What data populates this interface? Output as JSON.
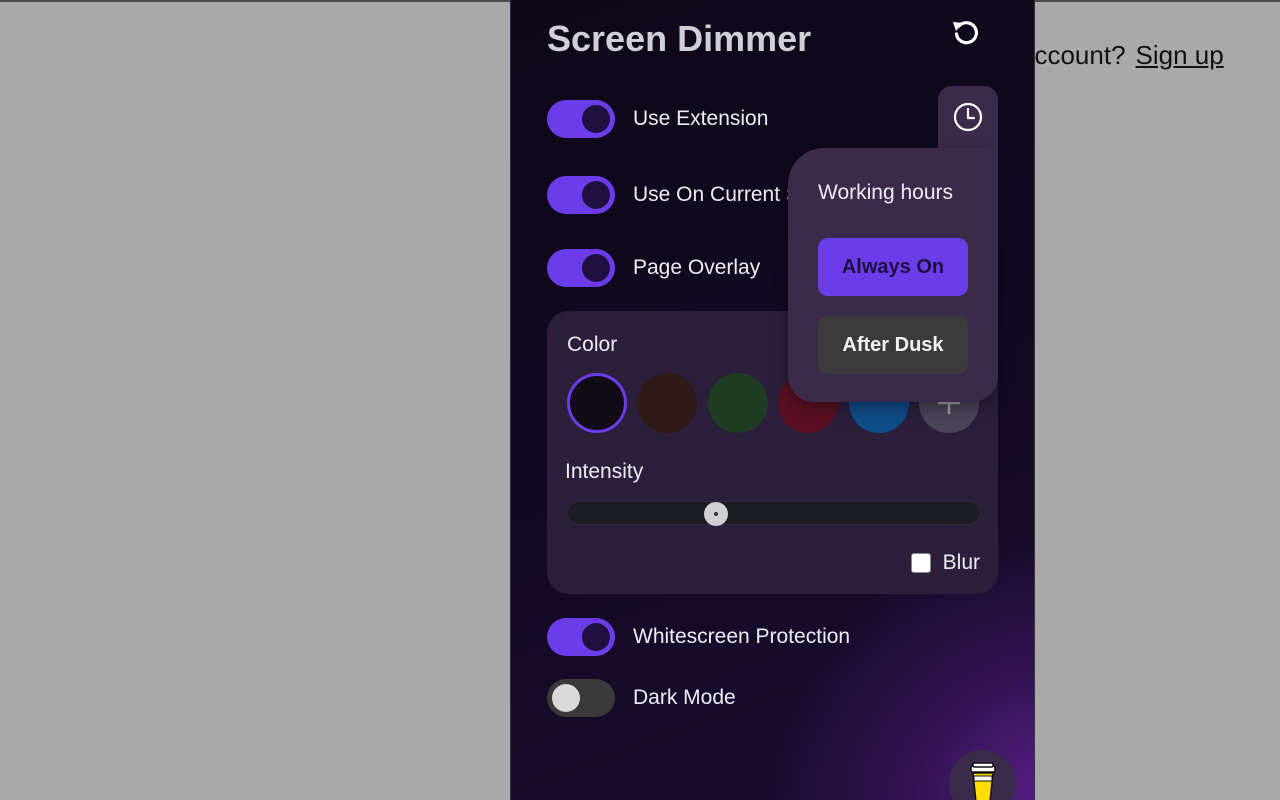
{
  "background_page": {
    "prompt": "account?",
    "signup_link": "Sign up"
  },
  "panel": {
    "title": "Screen Dimmer",
    "reset_icon": "reset-icon",
    "toggles": [
      {
        "label": "Use Extension",
        "on": true
      },
      {
        "label": "Use On Current Site",
        "on": true
      },
      {
        "label": "Page Overlay",
        "on": true
      },
      {
        "label": "Whitescreen Protection",
        "on": true
      },
      {
        "label": "Dark Mode",
        "on": false
      }
    ],
    "overlay": {
      "color_label": "Color",
      "swatches": [
        {
          "name": "black",
          "color": "#110c16",
          "selected": true
        },
        {
          "name": "brown",
          "color": "#2e1a16",
          "selected": false
        },
        {
          "name": "green",
          "color": "#1f3d22",
          "selected": false
        },
        {
          "name": "red",
          "color": "#5a1020",
          "selected": false
        },
        {
          "name": "blue",
          "color": "#0f4d8a",
          "selected": false
        }
      ],
      "add_icon": "add-color-icon",
      "intensity_label": "Intensity",
      "intensity_value": 0.36,
      "blur_label": "Blur",
      "blur_checked": false
    },
    "schedule": {
      "icon": "clock-icon",
      "title": "Working hours",
      "options": [
        "Always On",
        "After Dusk"
      ],
      "selected": "Always On"
    },
    "donate_icon": "coffee-cup-icon"
  },
  "colors": {
    "accent": "#6a3de8",
    "panel_card": "#2b1f3b",
    "popover": "#3a2b4a"
  }
}
